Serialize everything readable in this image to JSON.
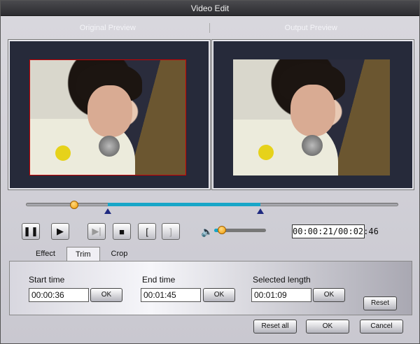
{
  "window": {
    "title": "Video Edit"
  },
  "preview": {
    "original_label": "Original Preview",
    "output_label": "Output Preview"
  },
  "playback": {
    "current_time": "00:00:21/00:02:46",
    "position_fraction": 0.13,
    "selection_start_fraction": 0.22,
    "selection_end_fraction": 0.63,
    "volume_fraction": 0.15
  },
  "controls": {
    "icons": [
      "pause-icon",
      "play-icon",
      "step-forward-icon",
      "stop-icon",
      "mark-in-icon",
      "mark-out-icon",
      "volume-icon"
    ]
  },
  "tabs": [
    {
      "label": "Effect"
    },
    {
      "label": "Trim"
    },
    {
      "label": "Crop"
    }
  ],
  "active_tab": "Trim",
  "trim": {
    "start_label": "Start time",
    "start_value": "00:00:36",
    "end_label": "End time",
    "end_value": "00:01:45",
    "length_label": "Selected length",
    "length_value": "00:01:09",
    "ok_label": "OK",
    "reset_label": "Reset"
  },
  "footer": {
    "reset_all_label": "Reset all",
    "ok_label": "OK",
    "cancel_label": "Cancel"
  }
}
